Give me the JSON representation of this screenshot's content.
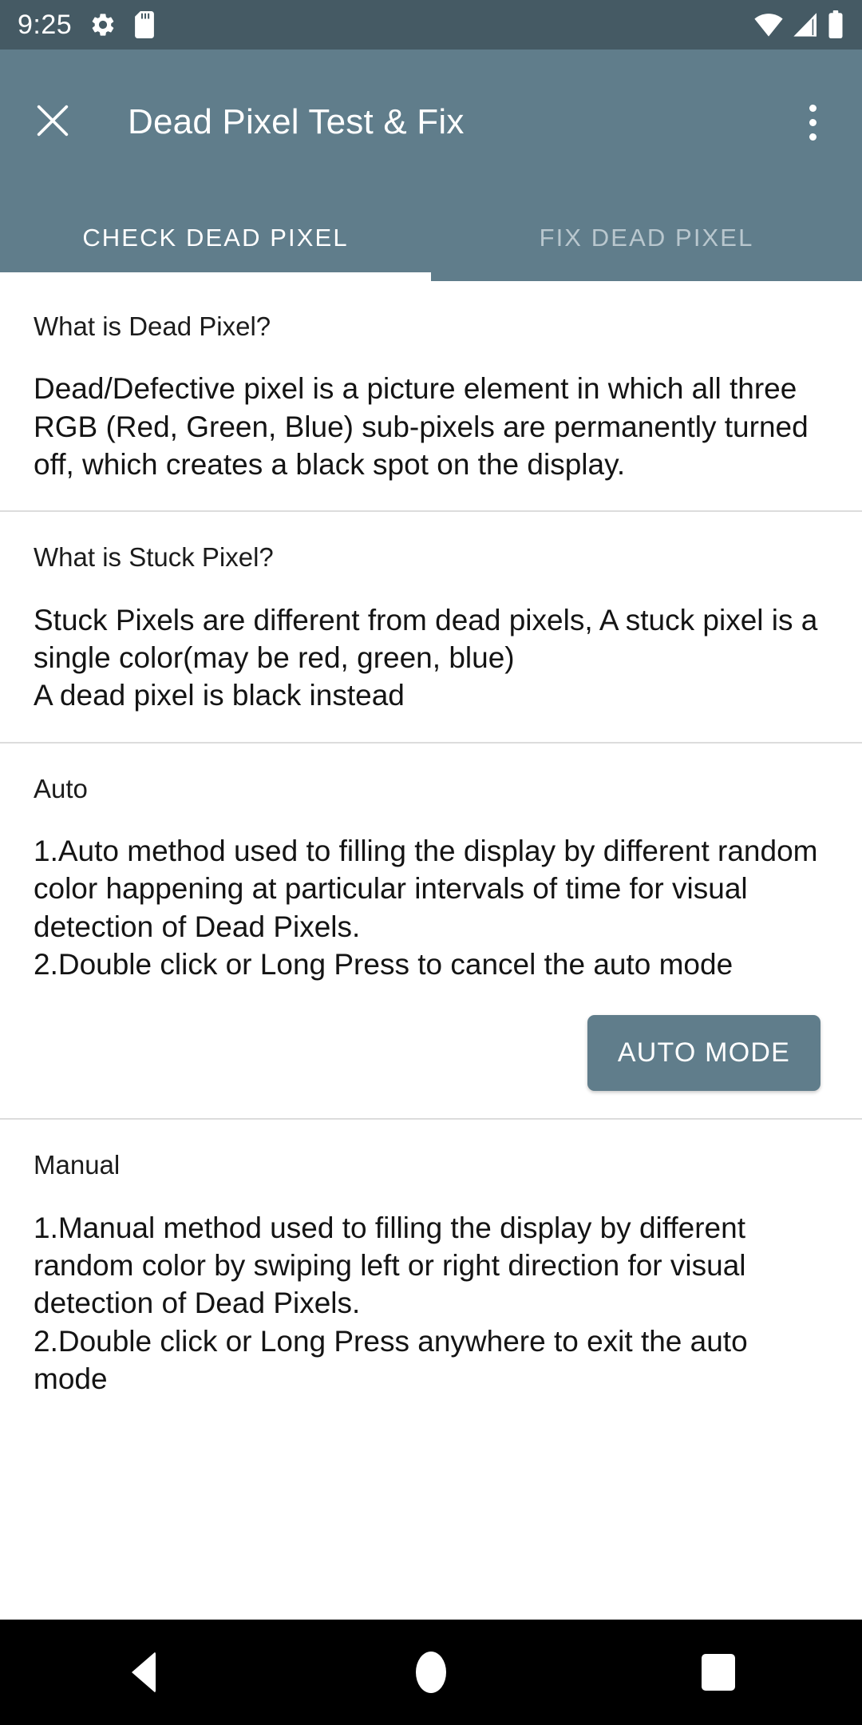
{
  "status_bar": {
    "time": "9:25",
    "icons_left": [
      "gear-icon",
      "sd-card-icon"
    ],
    "icons_right": [
      "wifi-icon",
      "cell-signal-icon",
      "battery-icon"
    ],
    "background_color": "#455A64"
  },
  "appbar": {
    "close_icon": "close-icon",
    "title": "Dead Pixel Test & Fix",
    "overflow_icon": "overflow-menu-icon",
    "background_color": "#607D8B"
  },
  "tabs": {
    "items": [
      {
        "label": "CHECK DEAD PIXEL",
        "active": true
      },
      {
        "label": "FIX DEAD PIXEL",
        "active": false
      }
    ],
    "indicator_color": "#FFFFFF"
  },
  "content": {
    "sections": [
      {
        "title": "What is Dead Pixel?",
        "body": "Dead/Defective pixel is a picture element in which all three RGB (Red, Green, Blue) sub-pixels are permanently turned off, which creates a black spot on the display."
      },
      {
        "title": "What is Stuck Pixel?",
        "body": "Stuck Pixels are different from dead pixels, A stuck pixel is a single color(may be red, green, blue)\n A dead pixel is black instead"
      },
      {
        "title": "Auto",
        "body": "1.Auto method used to filling the display by different random color happening at particular intervals of time for visual detection of Dead Pixels.\n2.Double click or Long Press to cancel the auto mode",
        "button_label": "AUTO MODE"
      },
      {
        "title": "Manual",
        "body": "1.Manual method used to filling the display by different random color by swiping left or right direction for visual detection of Dead Pixels.\n 2.Double click or Long Press anywhere to exit the auto mode"
      }
    ]
  },
  "navbar": {
    "back": "back-nav-icon",
    "home": "home-nav-icon",
    "recents": "recents-nav-icon",
    "background_color": "#000000"
  }
}
